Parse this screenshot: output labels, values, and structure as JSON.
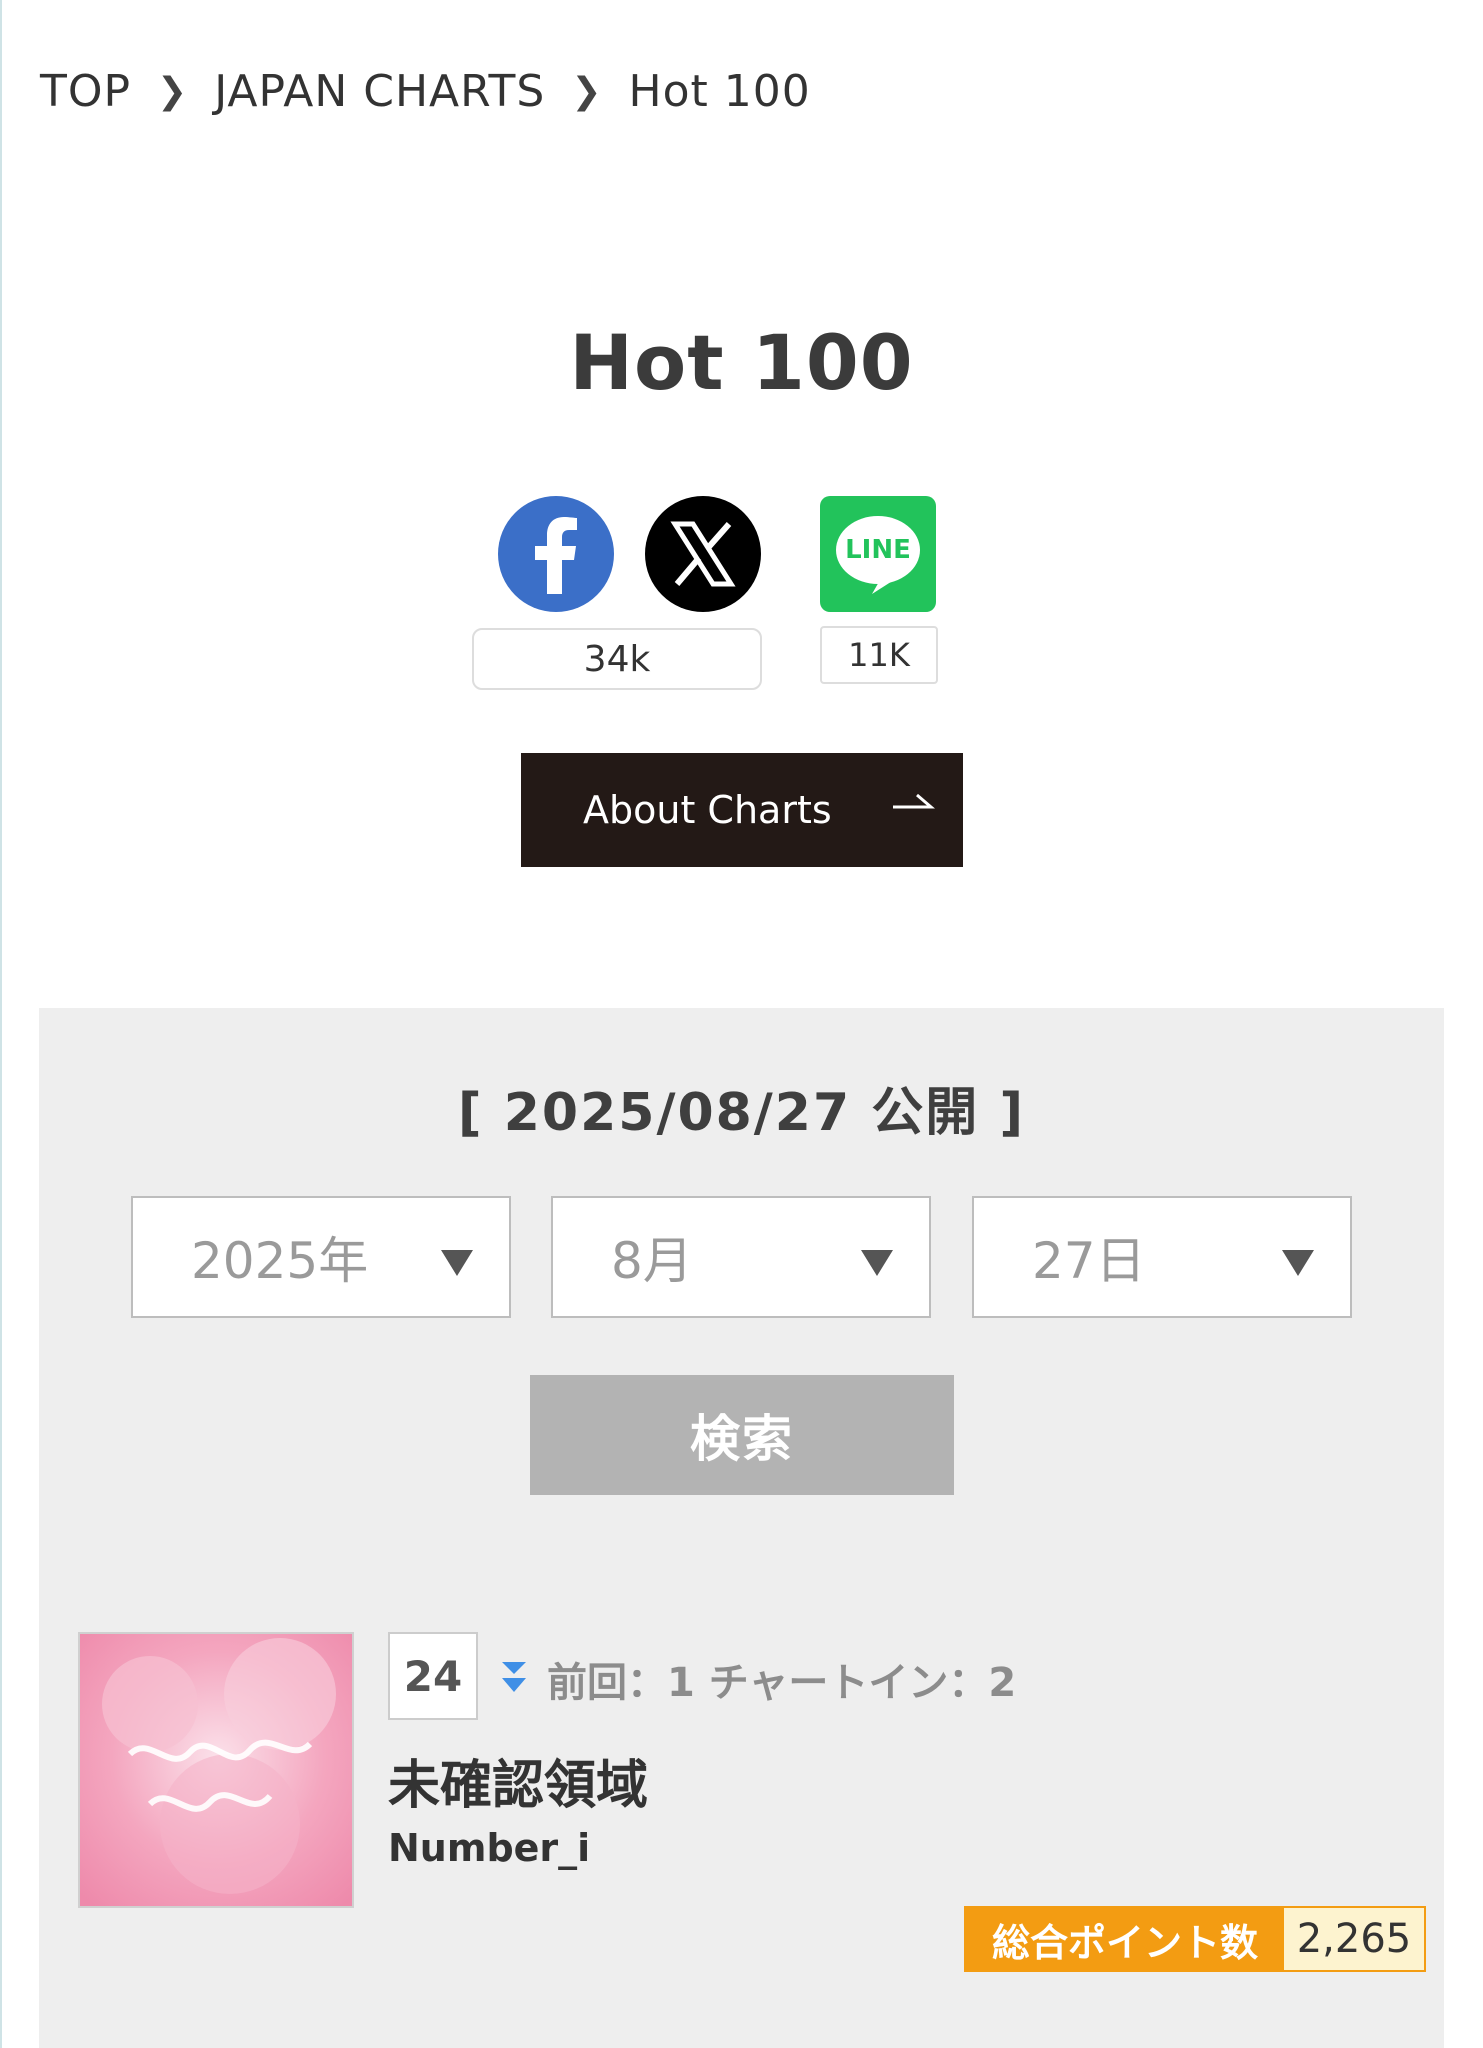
{
  "breadcrumb": {
    "top": "TOP",
    "section": "JAPAN CHARTS",
    "current": "Hot 100"
  },
  "page_title": "Hot 100",
  "share": {
    "facebook_icon": "facebook-icon",
    "x_icon": "x-icon",
    "line_icon": "line-icon",
    "line_icon_text": "LINE",
    "facebook_count": "34k",
    "line_count": "11K"
  },
  "about_button": {
    "label": "About Charts",
    "icon": "arrow-right-icon"
  },
  "chart_date": "[ 2025/08/27 公開 ]",
  "date_selects": {
    "year": "2025年",
    "month": "8月",
    "day": "27日"
  },
  "search_button": "検索",
  "entry": {
    "rank": "24",
    "trend_icon": "rank-down-icon",
    "prev_info": "前回：1 チャートイン：2",
    "title": "未確認領域",
    "artist": "Number_i",
    "points_label": "総合ポイント数",
    "points_value": "2,265"
  },
  "colors": {
    "facebook": "#3b6fc8",
    "line": "#22c35b",
    "about_bg": "#231916",
    "points_accent": "#f39c12",
    "trend_down": "#3f8fe6"
  }
}
